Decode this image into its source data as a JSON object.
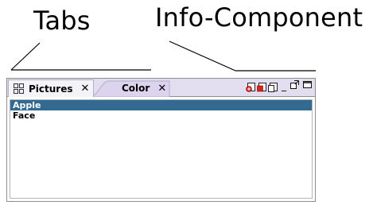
{
  "callouts": {
    "tabs_label": "Tabs",
    "info_label": "Info-Component"
  },
  "tabs": [
    {
      "label": "Pictures",
      "close": "✕",
      "icon": "grid-icon",
      "active": true
    },
    {
      "label": "Color",
      "close": "✕",
      "active": false
    }
  ],
  "info_component": {
    "icons": [
      "red-doc-icon-1",
      "red-doc-icon-2",
      "blank-doc-icon"
    ]
  },
  "window_controls": {
    "minimize": "_",
    "maximize_icon": "maximize-icon",
    "restore_icon": "restore-icon"
  },
  "list": {
    "items": [
      {
        "label": "Apple",
        "selected": true
      },
      {
        "label": "Face",
        "selected": false
      }
    ]
  },
  "colors": {
    "tab_strip": "#e3ddf0",
    "selection": "#336a92",
    "border": "#8f8f8f"
  }
}
